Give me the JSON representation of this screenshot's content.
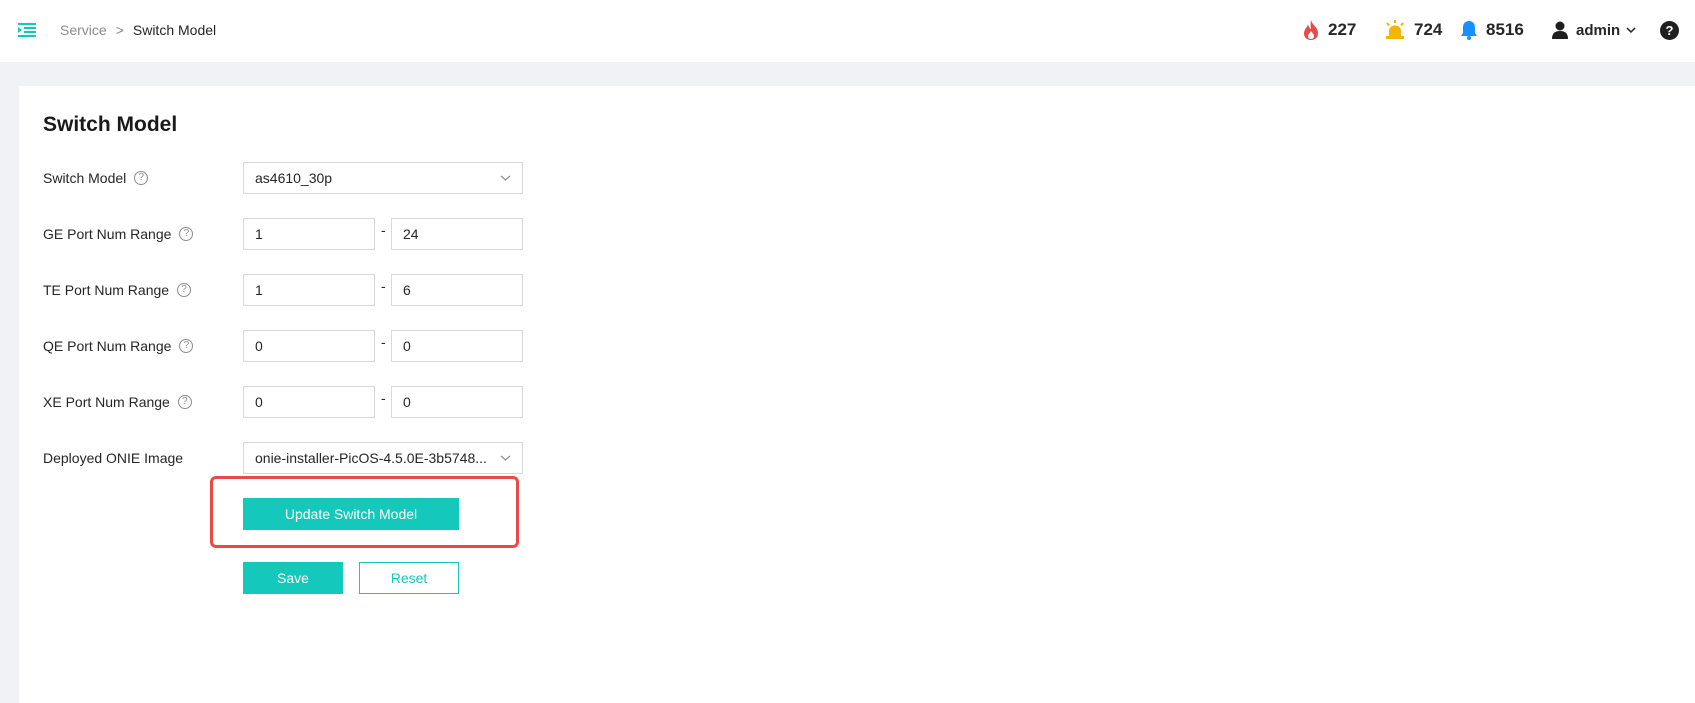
{
  "header": {
    "breadcrumb": {
      "parent": "Service",
      "separator": ">",
      "current": "Switch Model"
    },
    "stats": {
      "critical": {
        "icon": "fire-icon",
        "value": "227",
        "color": "#e84a4a"
      },
      "warning": {
        "icon": "siren-icon",
        "value": "724",
        "color": "#f5b400"
      },
      "notifications": {
        "icon": "bell-icon",
        "value": "8516",
        "color": "#1890ff"
      }
    },
    "user": {
      "name": "admin"
    },
    "help_label": "?"
  },
  "page": {
    "title": "Switch Model"
  },
  "form": {
    "switch_model": {
      "label": "Switch Model",
      "value": "as4610_30p"
    },
    "ge_range": {
      "label": "GE Port Num Range",
      "from": "1",
      "to": "24"
    },
    "te_range": {
      "label": "TE Port Num Range",
      "from": "1",
      "to": "6"
    },
    "qe_range": {
      "label": "QE Port Num Range",
      "from": "0",
      "to": "0"
    },
    "xe_range": {
      "label": "XE Port Num Range",
      "from": "0",
      "to": "0"
    },
    "onie_image": {
      "label": "Deployed ONIE Image",
      "value": "onie-installer-PicOS-4.5.0E-3b5748..."
    },
    "range_separator": "-",
    "help_glyph": "?"
  },
  "buttons": {
    "update_model": "Update Switch Model",
    "save": "Save",
    "reset": "Reset"
  },
  "colors": {
    "accent": "#14c9bb",
    "highlight": "#e84a4a",
    "background": "#f0f2f5"
  }
}
